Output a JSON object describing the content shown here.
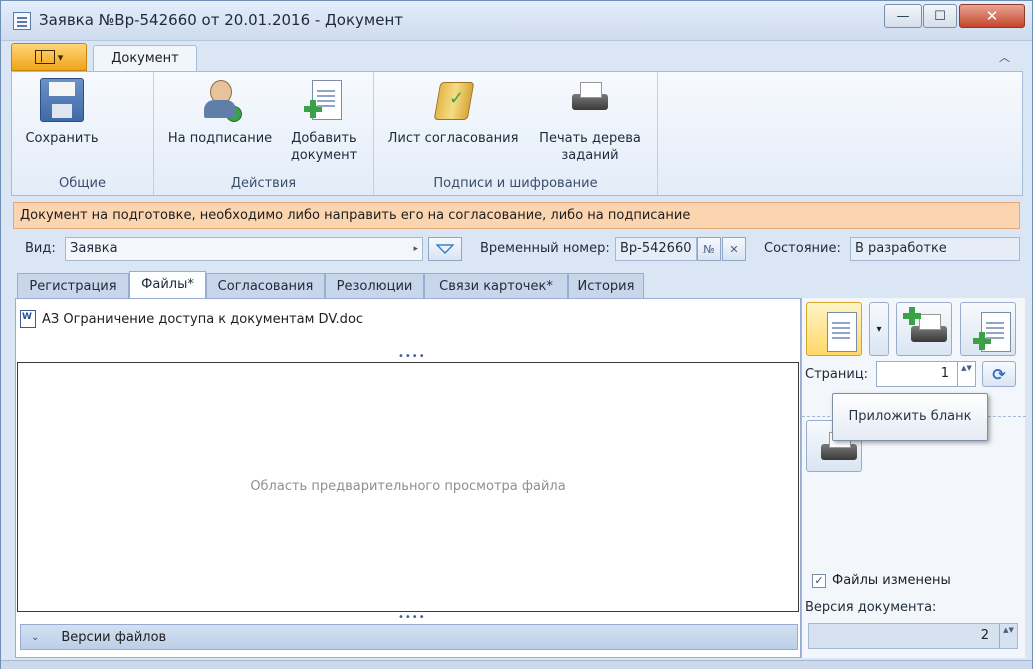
{
  "window": {
    "title": "Заявка №Вр-542660 от 20.01.2016 - Документ",
    "min_glyph": "—",
    "max_glyph": "☐",
    "close_glyph": "✕"
  },
  "ribbon": {
    "app_menu_arrow": "▾",
    "tab": "Документ",
    "collapse_glyph": "︿",
    "groups": [
      {
        "label": "Общие",
        "buttons": [
          "Сохранить"
        ]
      },
      {
        "label": "Действия",
        "buttons": [
          "На подписание",
          "Добавить документ"
        ]
      },
      {
        "label": "Подписи и шифрование",
        "buttons": [
          "Лист согласования",
          "Печать дерева заданий"
        ]
      }
    ]
  },
  "infobar": {
    "text": "Документ на подготовке, необходимо либо направить его на согласование, либо на подписание"
  },
  "fields": {
    "kind_label": "Вид:",
    "kind_value": "Заявка",
    "kind_arrow": "▸",
    "temp_number_label": "Временный номер:",
    "temp_number_value": "Вр-542660",
    "number_glyph": "№",
    "clear_glyph": "✕",
    "state_label": "Состояние:",
    "state_value": "В разработке"
  },
  "tabs": [
    "Регистрация",
    "Файлы*",
    "Согласования",
    "Резолюции",
    "Связи карточек*",
    "История"
  ],
  "active_tab": 1,
  "files": {
    "items": [
      "АЗ Ограничение доступа к документам DV.doc"
    ],
    "splitter_dots": "••••",
    "preview_placeholder": "Область предварительного просмотра файла",
    "versions_label": "Версии файлов",
    "versions_chevron": "⌄"
  },
  "side": {
    "split_arrow": "▾",
    "pages_label": "Страниц:",
    "pages_value": "1",
    "spin_glyphs": "▲▼",
    "refresh_glyph": "⟳",
    "tooltip": "Приложить бланк",
    "files_changed_label": "Файлы изменены",
    "files_changed_checked": true,
    "check_glyph": "✓",
    "doc_version_label": "Версия документа:",
    "doc_version_value": "2"
  }
}
